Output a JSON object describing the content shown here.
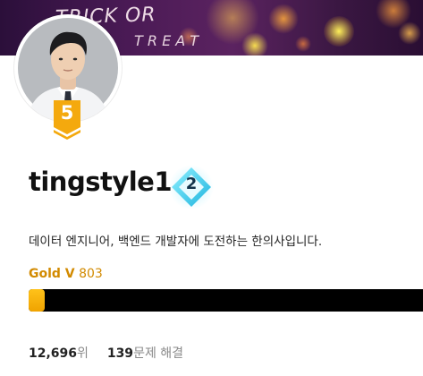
{
  "banner": {
    "text_line1": "TRICK OR",
    "text_line2": "T R E A T"
  },
  "profile": {
    "handle": "tingstyle1",
    "tier_level_badge": "5",
    "class_badge": "2",
    "bio": "데이터 엔지니어, 백엔드 개발자에 도전하는 한의사입니다.",
    "tier_name": "Gold V",
    "rating": "803",
    "progress_fraction": 0.04
  },
  "stats": {
    "rank_value": "12,696",
    "rank_unit": "위",
    "solved_value": "139",
    "solved_unit": "문제 해결"
  },
  "colors": {
    "tier_gold": "#d28a00",
    "progress_track": "#000000",
    "progress_fill": "#ffb300",
    "class_badge": "#37c7e8"
  },
  "icons": {
    "tier_badge": "gold-tier-chevron-icon",
    "class_badge": "diamond-class-icon"
  }
}
